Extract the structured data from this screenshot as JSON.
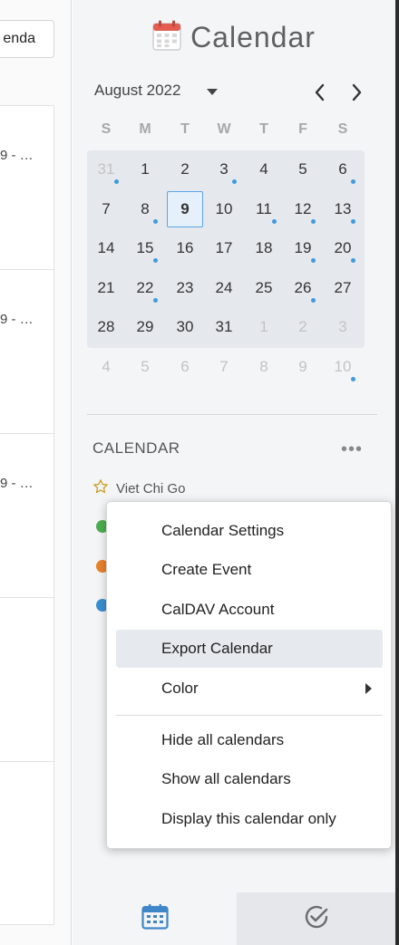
{
  "left": {
    "agenda_button": "enda",
    "rows": [
      "9 - …",
      "9 - …",
      "9 - …"
    ]
  },
  "calendar": {
    "title": "Calendar",
    "month_label": "August 2022",
    "weekdays": [
      "S",
      "M",
      "T",
      "W",
      "T",
      "F",
      "S"
    ],
    "weeks": [
      [
        {
          "d": "31",
          "o": true,
          "dot": true
        },
        {
          "d": "1"
        },
        {
          "d": "2"
        },
        {
          "d": "3",
          "dot": true
        },
        {
          "d": "4"
        },
        {
          "d": "5"
        },
        {
          "d": "6",
          "dot": true
        }
      ],
      [
        {
          "d": "7"
        },
        {
          "d": "8",
          "dot": true
        },
        {
          "d": "9",
          "today": true
        },
        {
          "d": "10"
        },
        {
          "d": "11",
          "dot": true
        },
        {
          "d": "12",
          "dot": true
        },
        {
          "d": "13",
          "dot": true
        }
      ],
      [
        {
          "d": "14"
        },
        {
          "d": "15",
          "dot": true
        },
        {
          "d": "16"
        },
        {
          "d": "17"
        },
        {
          "d": "18"
        },
        {
          "d": "19",
          "dot": true
        },
        {
          "d": "20",
          "dot": true
        }
      ],
      [
        {
          "d": "21"
        },
        {
          "d": "22",
          "dot": true
        },
        {
          "d": "23"
        },
        {
          "d": "24"
        },
        {
          "d": "25"
        },
        {
          "d": "26",
          "dot": true
        },
        {
          "d": "27"
        }
      ],
      [
        {
          "d": "28"
        },
        {
          "d": "29"
        },
        {
          "d": "30"
        },
        {
          "d": "31"
        },
        {
          "d": "1",
          "o": true
        },
        {
          "d": "2",
          "o": true
        },
        {
          "d": "3",
          "o": true
        }
      ],
      [
        {
          "d": "4",
          "o": true
        },
        {
          "d": "5",
          "o": true
        },
        {
          "d": "6",
          "o": true
        },
        {
          "d": "7",
          "o": true
        },
        {
          "d": "8",
          "o": true
        },
        {
          "d": "9",
          "o": true
        },
        {
          "d": "10",
          "o": true,
          "dot": true
        }
      ]
    ]
  },
  "calendars_section": {
    "label": "CALENDAR",
    "user_name": "Viet Chi Go",
    "calendar_colors": [
      "#4caf50",
      "#e8832a",
      "#3a8fd0"
    ]
  },
  "context_menu": {
    "items": [
      {
        "label": "Calendar Settings"
      },
      {
        "label": "Create Event"
      },
      {
        "label": "CalDAV Account"
      },
      {
        "label": "Export Calendar",
        "highlighted": true
      },
      {
        "label": "Color",
        "submenu": true
      }
    ],
    "items2": [
      {
        "label": "Hide all calendars"
      },
      {
        "label": "Show all calendars"
      },
      {
        "label": "Display this calendar only"
      }
    ]
  },
  "icons": {
    "title_icon": "calendar-icon",
    "nav_prev": "chevron-left-icon",
    "nav_next": "chevron-right-icon",
    "user_icon": "star-icon",
    "bottom_calendar": "calendar-grid-icon",
    "bottom_tasks": "check-circle-icon"
  },
  "colors": {
    "accent": "#3f9be0",
    "star": "#c9a227"
  }
}
